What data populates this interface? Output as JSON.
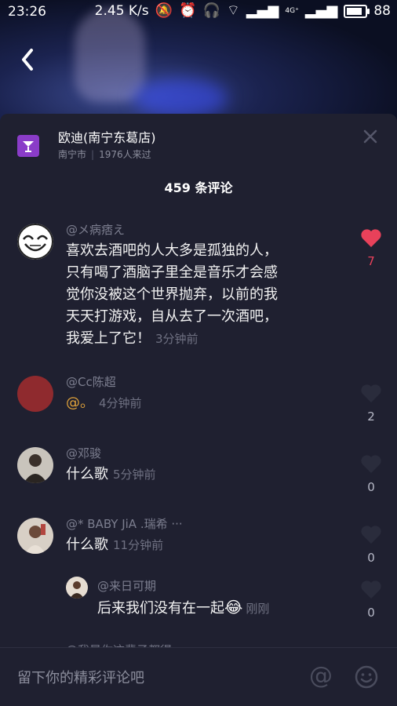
{
  "status_bar": {
    "time": "23:26",
    "speed": "2.45 K/s",
    "network": "4G⁺",
    "battery": "88"
  },
  "venue": {
    "name": "欧迪(南宁东葛店)",
    "city": "南宁市",
    "visitors": "1976人来过"
  },
  "comment_count": "459 条评论",
  "comments": [
    {
      "user": "@メ病痞え",
      "text_lines": [
        "喜欢去酒吧的人大多是孤独的人，",
        "只有喝了酒脑子里全是音乐才会感",
        "觉你没被这个世界抛弃，以前的我",
        "天天打游戏，自从去了一次酒吧，",
        "我爱上了它！"
      ],
      "time": "3分钟前",
      "likes": "7",
      "liked": true
    },
    {
      "user": "@Cc陈超",
      "text": "@。",
      "time": "4分钟前",
      "likes": "2"
    },
    {
      "user": "@邓骏",
      "text": "什么歌",
      "time": "5分钟前",
      "likes": "0"
    },
    {
      "user": "@* BABY JiA .瑞希 ···",
      "text": "什么歌",
      "time": "11分钟前",
      "likes": "0"
    }
  ],
  "reply": {
    "user": "@来日可期",
    "text": "后来我们没有在一起",
    "time": "刚刚",
    "likes": "0"
  },
  "peek_user": "@我是你这辈子都得",
  "input": {
    "placeholder": "留下你的精彩评论吧"
  },
  "colors": {
    "panel": "#1f2030",
    "like_red": "#e8415a",
    "venue_icon": "#8a3cc8"
  }
}
